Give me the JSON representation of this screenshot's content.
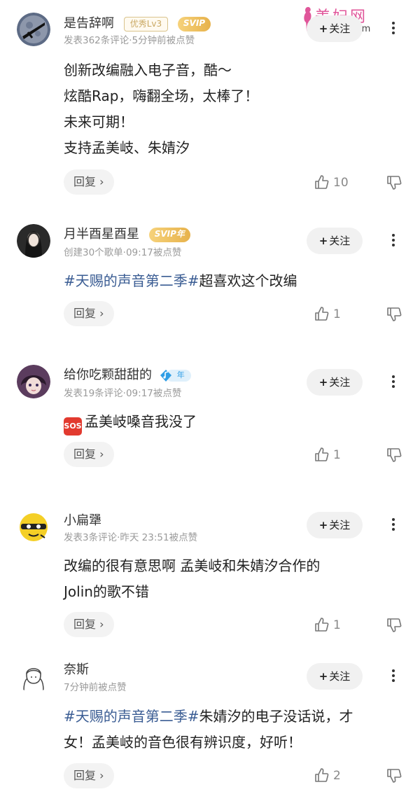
{
  "watermark": {
    "title": "美妇网",
    "url": "meifu3.com"
  },
  "comments": [
    {
      "username": "是告辞啊",
      "badge_level": "优秀Lv3",
      "badge_svip": "SVIP",
      "meta": "发表362条评论·5分钟前被点赞",
      "follow_label": "关注",
      "lines": [
        "创新改编融入电子音，酷～",
        "炫酷Rap，嗨翻全场，太棒了！",
        "未来可期！",
        "支持孟美岐、朱婧汐"
      ],
      "reply_label": "回复",
      "likes": "10"
    },
    {
      "username": "月半酉星酉星",
      "badge_svip": "SVIP年",
      "meta": "创建30个歌单·09:17被点赞",
      "follow_label": "关注",
      "hashtag": "#天赐的声音第二季#",
      "text": "超喜欢这个改编",
      "reply_label": "回复",
      "likes": "1"
    },
    {
      "username": "给你吃颗甜甜的",
      "badge_music": "年",
      "meta": "发表19条评论·09:17被点赞",
      "follow_label": "关注",
      "sos": "SOS",
      "text": "孟美岐嗓音我没了",
      "reply_label": "回复",
      "likes": "1"
    },
    {
      "username": "小扁犟",
      "meta": "发表3条评论·昨天 23:51被点赞",
      "follow_label": "关注",
      "lines": [
        "改编的很有意思啊 孟美岐和朱婧汐合作的",
        "Jolin的歌不错"
      ],
      "reply_label": "回复",
      "likes": "1"
    },
    {
      "username": "奈斯",
      "meta": "7分钟前被点赞",
      "follow_label": "关注",
      "hashtag": "#天赐的声音第二季#",
      "text_line1": "朱婧汐的电子没话说，才",
      "text_line2": "女！孟美岐的音色很有辨识度，好听！",
      "reply_label": "回复",
      "likes": "2"
    }
  ]
}
